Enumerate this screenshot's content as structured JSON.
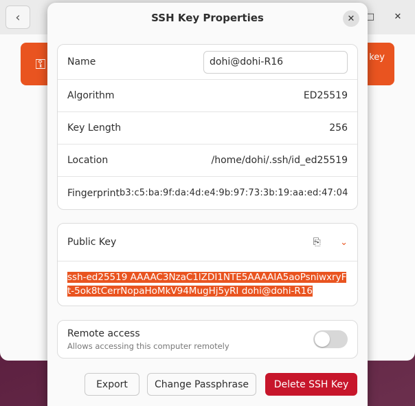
{
  "background": {
    "back_icon": "chevron-left-icon",
    "max_icon": "maximize-icon",
    "close_icon": "close-icon",
    "card_icon": "key-icon",
    "card_text_partial": "key",
    "accent": "#e95420"
  },
  "dialog": {
    "title": "SSH Key Properties",
    "close_icon": "close-icon"
  },
  "properties": {
    "name_label": "Name",
    "name_value": "dohi@dohi-R16",
    "algorithm_label": "Algorithm",
    "algorithm_value": "ED25519",
    "key_length_label": "Key Length",
    "key_length_value": "256",
    "location_label": "Location",
    "location_value": "/home/dohi/.ssh/id_ed25519",
    "fingerprint_label": "Fingerprint",
    "fingerprint_value": "b3:c5:ba:9f:da:4d:e4:9b:97:73:3b:19:aa:ed:47:04"
  },
  "public_key": {
    "label": "Public Key",
    "copy_icon": "copy-icon",
    "expand_icon": "chevron-down-icon",
    "value": "ssh-ed25519 AAAAC3NzaC1lZDI1NTE5AAAAIA5aoPsniwxryFt-5ok8tCerrNopaHoMkV94MugHj5yRI dohi@dohi-R16"
  },
  "remote_access": {
    "title": "Remote access",
    "subtitle": "Allows accessing this computer remotely",
    "enabled": false
  },
  "buttons": {
    "export": "Export",
    "change_passphrase": "Change Passphrase",
    "delete": "Delete SSH Key"
  },
  "colors": {
    "accent": "#e95420",
    "destructive": "#c7162b"
  }
}
